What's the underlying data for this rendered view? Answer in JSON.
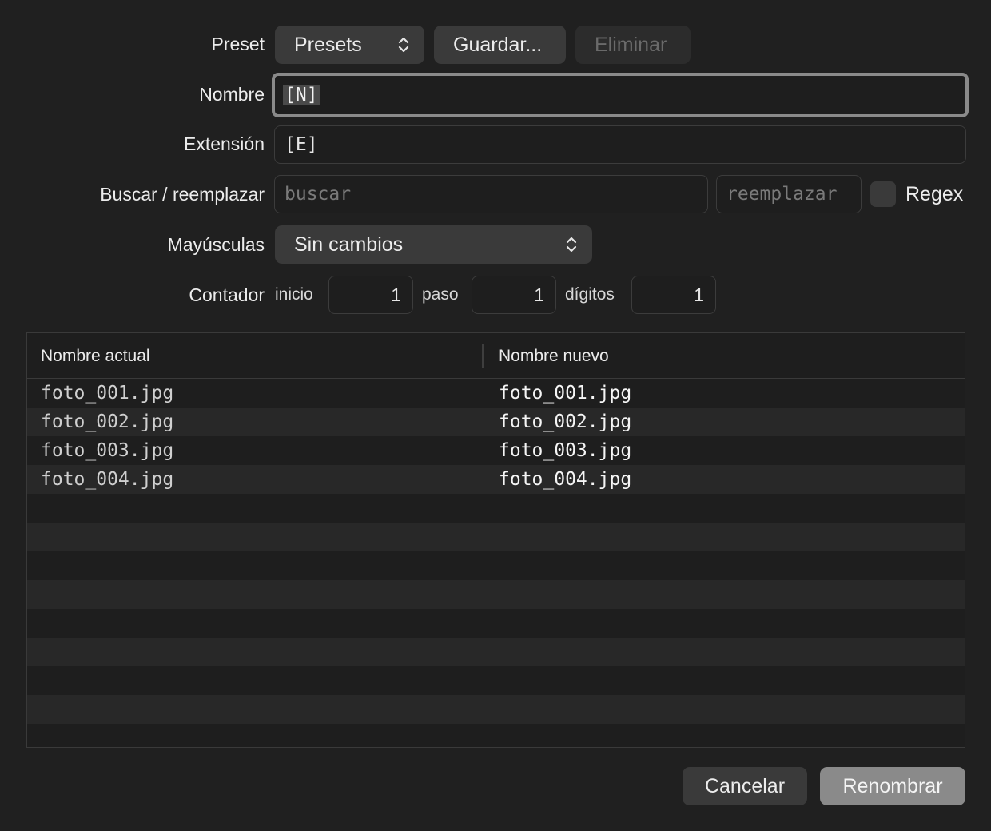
{
  "form": {
    "preset_label": "Preset",
    "preset_select": "Presets",
    "save_button": "Guardar...",
    "delete_button": "Eliminar",
    "name_label": "Nombre",
    "name_value": "[N]",
    "extension_label": "Extensión",
    "extension_value": "[E]",
    "search_replace_label": "Buscar / reemplazar",
    "search_placeholder": "buscar",
    "replace_placeholder": "reemplazar",
    "regex_label": "Regex",
    "regex_checked": false,
    "case_label": "Mayúsculas",
    "case_select": "Sin cambios",
    "counter_label": "Contador",
    "start_label": "inicio",
    "start_value": "1",
    "step_label": "paso",
    "step_value": "1",
    "digits_label": "dígitos",
    "digits_value": "1"
  },
  "table": {
    "columns": [
      "Nombre actual",
      "Nombre nuevo"
    ],
    "rows": [
      {
        "current": "foto_001.jpg",
        "new": "foto_001.jpg"
      },
      {
        "current": "foto_002.jpg",
        "new": "foto_002.jpg"
      },
      {
        "current": "foto_003.jpg",
        "new": "foto_003.jpg"
      },
      {
        "current": "foto_004.jpg",
        "new": "foto_004.jpg"
      }
    ]
  },
  "footer": {
    "cancel_button": "Cancelar",
    "rename_button": "Renombrar"
  },
  "colors": {
    "background": "#202020",
    "control": "#3a3a3a",
    "primary_button": "#8a8a8a",
    "focus_ring": "#8a8a8a"
  }
}
